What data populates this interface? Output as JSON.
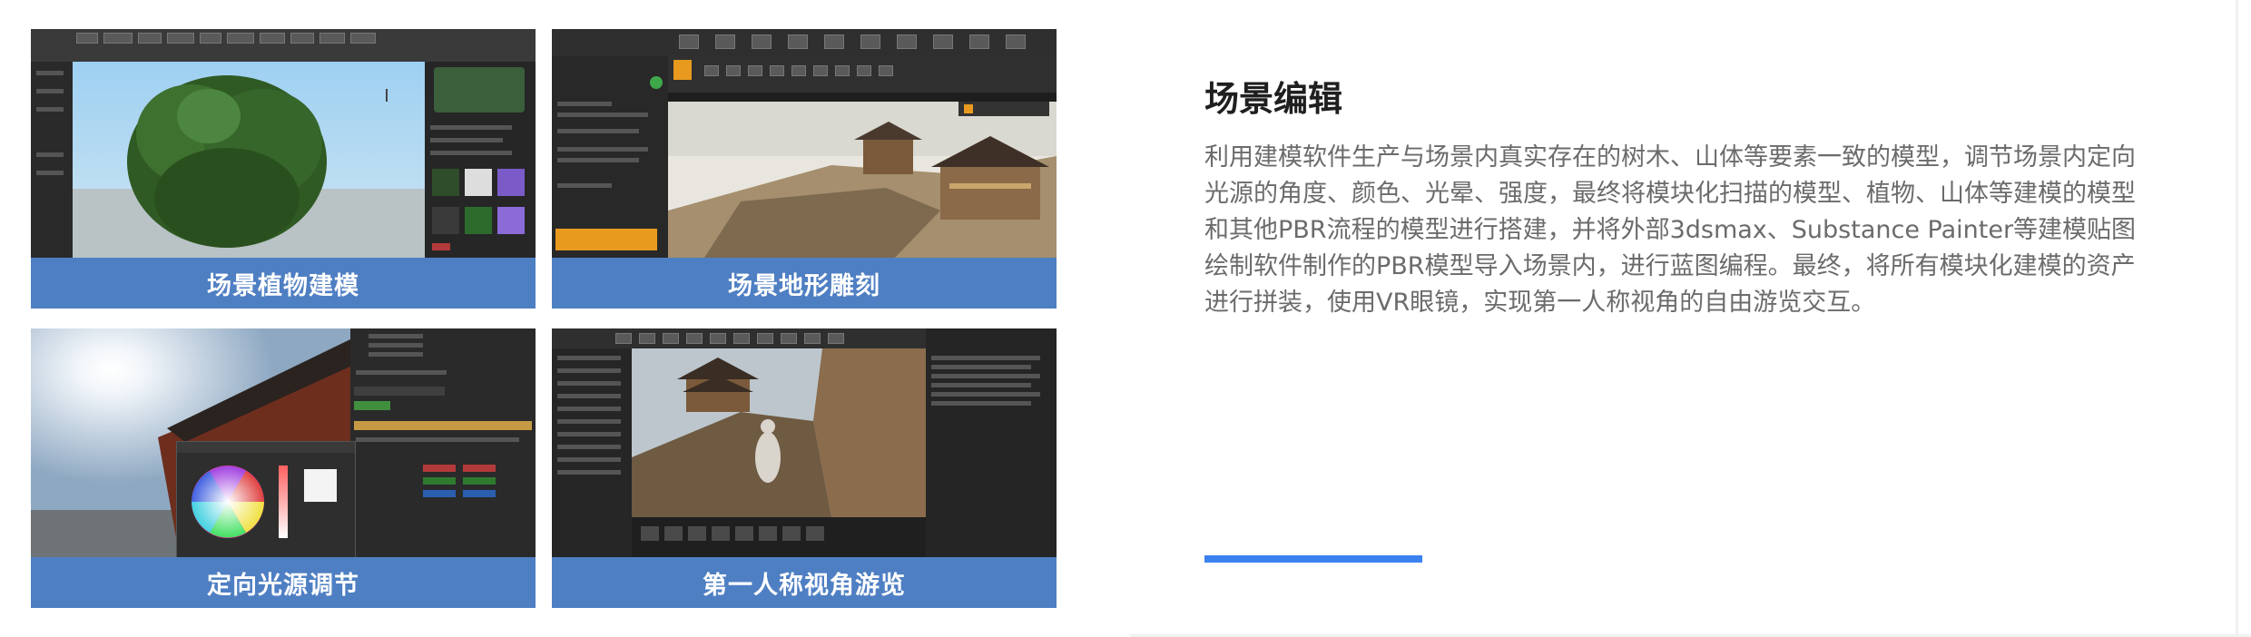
{
  "cards": [
    {
      "caption": "场景植物建模",
      "icon": "tree-model-screenshot"
    },
    {
      "caption": "场景地形雕刻",
      "icon": "terrain-editor-screenshot"
    },
    {
      "caption": "定向光源调节",
      "icon": "light-color-picker-screenshot"
    },
    {
      "caption": "第一人称视角游览",
      "icon": "first-person-walkthrough-screenshot"
    }
  ],
  "panel": {
    "title": "场景编辑",
    "description": "利用建模软件生产与场景内真实存在的树木、山体等要素一致的模型，调节场景内定向光源的角度、颜色、光晕、强度，最终将模块化扫描的模型、植物、山体等建模的模型和其他PBR流程的模型进行搭建，并将外部3dsmax、Substance Painter等建模贴图绘制软件制作的PBR模型导入场景内，进行蓝图编程。最终，将所有模块化建模的资产进行拼装，使用VR眼镜，实现第一人称视角的自由游览交互。"
  },
  "colors": {
    "caption_bg": "#4f7fc3",
    "accent": "#3b82f0",
    "title": "#1f1f1f",
    "desc": "#6b6b6b"
  }
}
